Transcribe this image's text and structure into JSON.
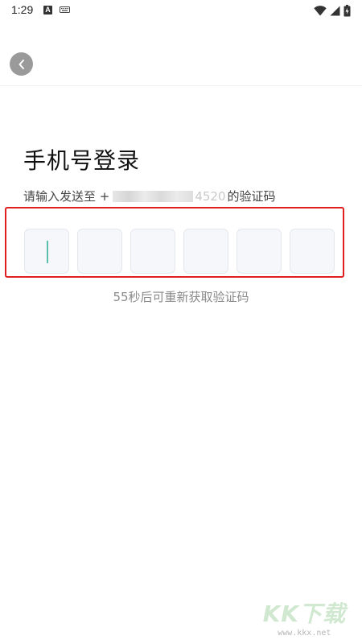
{
  "status_bar": {
    "time": "1:29",
    "notification_icons": [
      "a-app-icon",
      "keyboard-icon"
    ],
    "system_icons": [
      "wifi-icon",
      "signal-icon",
      "battery-charging-icon"
    ]
  },
  "nav": {
    "back_icon": "chevron-left-icon"
  },
  "login": {
    "title": "手机号登录",
    "subtitle_prefix": "请输入发送至 +",
    "phone_visible_suffix": "4520",
    "subtitle_suffix": " 的验证码",
    "code_length": 6,
    "code_values": [
      "",
      "",
      "",
      "",
      "",
      ""
    ],
    "resend_text": "55秒后可重新获取验证码"
  },
  "colors": {
    "caret": "#5bbfae",
    "highlight_border": "#e02020",
    "code_box_bg": "#f6f7fb",
    "back_button_bg": "#9a9a9a"
  },
  "watermark": {
    "logo": "KK下载",
    "url": "www.kkx.net"
  }
}
